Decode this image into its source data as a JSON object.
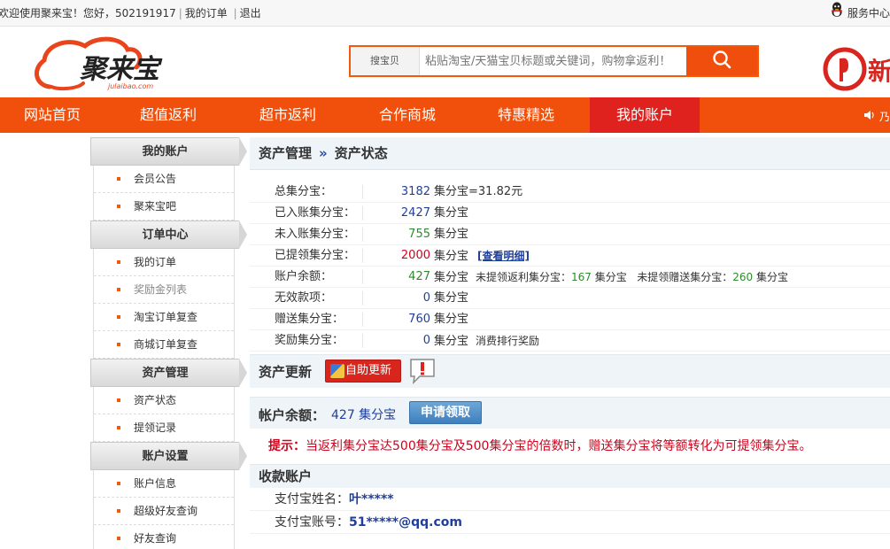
{
  "topbar": {
    "welcome": "欢迎使用聚来宝！您好，502191917",
    "my_orders": "我的订单",
    "logout": "退出",
    "service": "服务中心"
  },
  "header": {
    "logo_text": "聚来宝",
    "logo_domain": "julaibao.com",
    "search_label": "搜宝贝",
    "search_placeholder": "粘贴淘宝/天猫宝贝标题或关键词，购物拿返利！",
    "promo_text": "新"
  },
  "nav": {
    "items": [
      "网站首页",
      "超值返利",
      "超市返利",
      "合作商城",
      "特惠精选",
      "我的账户"
    ],
    "active": "我的账户",
    "speaker_text": "乃"
  },
  "sidebar": {
    "groups": [
      {
        "title": "我的账户",
        "items": [
          "会员公告",
          "聚来宝吧"
        ]
      },
      {
        "title": "订单中心",
        "items": [
          "我的订单",
          "奖励金列表",
          "淘宝订单复查",
          "商城订单复查"
        ]
      },
      {
        "title": "资产管理",
        "items": [
          "资产状态",
          "提领记录"
        ]
      },
      {
        "title": "账户设置",
        "items": [
          "账户信息",
          "超级好友查询",
          "好友查询"
        ]
      }
    ]
  },
  "content": {
    "breadcrumb_parent": "资产管理",
    "breadcrumb_arrow": "»",
    "breadcrumb_current": "资产状态",
    "stats": [
      {
        "label": "总集分宝：",
        "value": "3182",
        "unit": "集分宝",
        "suffix": "=31.82元"
      },
      {
        "label": "已入账集分宝：",
        "value": "2427",
        "unit": "集分宝"
      },
      {
        "label": "未入账集分宝：",
        "value": "755",
        "unit": "集分宝"
      },
      {
        "label": "已提领集分宝：",
        "value": "2000",
        "unit": "集分宝",
        "link": "[查看明细]"
      },
      {
        "label": "账户余额：",
        "value": "427",
        "unit": "集分宝",
        "note_a": "未提领返利集分宝：",
        "note_a_val": "167",
        "note_a_unit": "集分宝",
        "note_b": "未提领赠送集分宝：",
        "note_b_val": "260",
        "note_b_unit": "集分宝"
      },
      {
        "label": "无效款项：",
        "value": "0",
        "unit": "集分宝"
      },
      {
        "label": "赠送集分宝：",
        "value": "760",
        "unit": "集分宝"
      },
      {
        "label": "奖励集分宝：",
        "value": "0",
        "unit": "集分宝",
        "note": "消费排行奖励"
      }
    ],
    "update_title": "资产更新",
    "update_button": "自助更新",
    "balance_title": "帐户余额：",
    "balance_amount": "427 集分宝",
    "apply_button": "申请领取",
    "tip_label": "提示：",
    "tip_text": "当返利集分宝达500集分宝及500集分宝的倍数时，赠送集分宝将等额转化为可提领集分宝。",
    "account_title": "收款账户",
    "alipay_name_label": "支付宝姓名：",
    "alipay_name": "叶*****",
    "alipay_account_label": "支付宝账号：",
    "alipay_account": "51*****@qq.com"
  },
  "colors": {
    "brand_orange": "#f0500c",
    "nav_active_red": "#e0221f",
    "link_blue": "#1f3f9c"
  }
}
